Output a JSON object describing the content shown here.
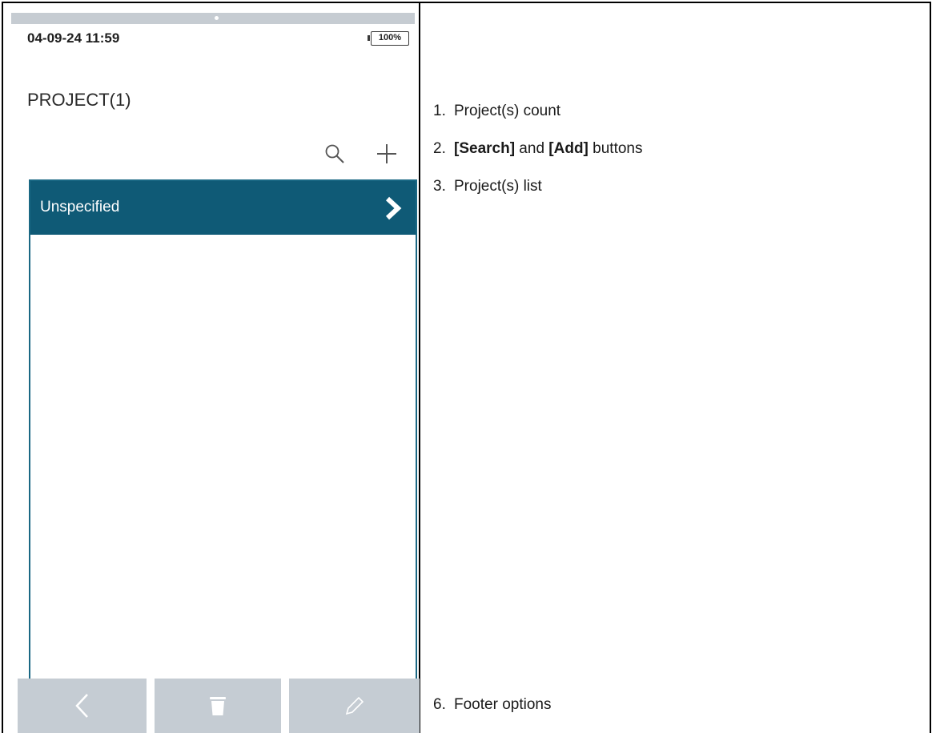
{
  "device": {
    "status": {
      "time": "04-09-24 11:59",
      "battery": "100%"
    },
    "title": "PROJECT(1)",
    "toolbar": {
      "search_icon": "search-icon",
      "add_icon": "plus-icon"
    },
    "list": {
      "items": [
        {
          "label": "Unspecified",
          "icon": "chevron-right-icon"
        }
      ]
    },
    "footer": {
      "buttons": [
        {
          "icon": "chevron-left-icon"
        },
        {
          "icon": "trash-icon"
        },
        {
          "icon": "pencil-icon"
        }
      ]
    },
    "colors": {
      "header": "#0f5a76",
      "list_border": "#1a6884",
      "footer": "#c5ccd3",
      "topbar": "#c6ccd2"
    }
  },
  "notes": {
    "item1": {
      "num": "1.",
      "text": "Project(s) count"
    },
    "item2": {
      "num": "2.",
      "bold1": "[Search]",
      "mid": " and ",
      "bold2": "[Add]",
      "end": " buttons"
    },
    "item3": {
      "num": "3.",
      "text": "Project(s) list"
    },
    "item6": {
      "num": "6.",
      "text": "Footer options"
    }
  }
}
